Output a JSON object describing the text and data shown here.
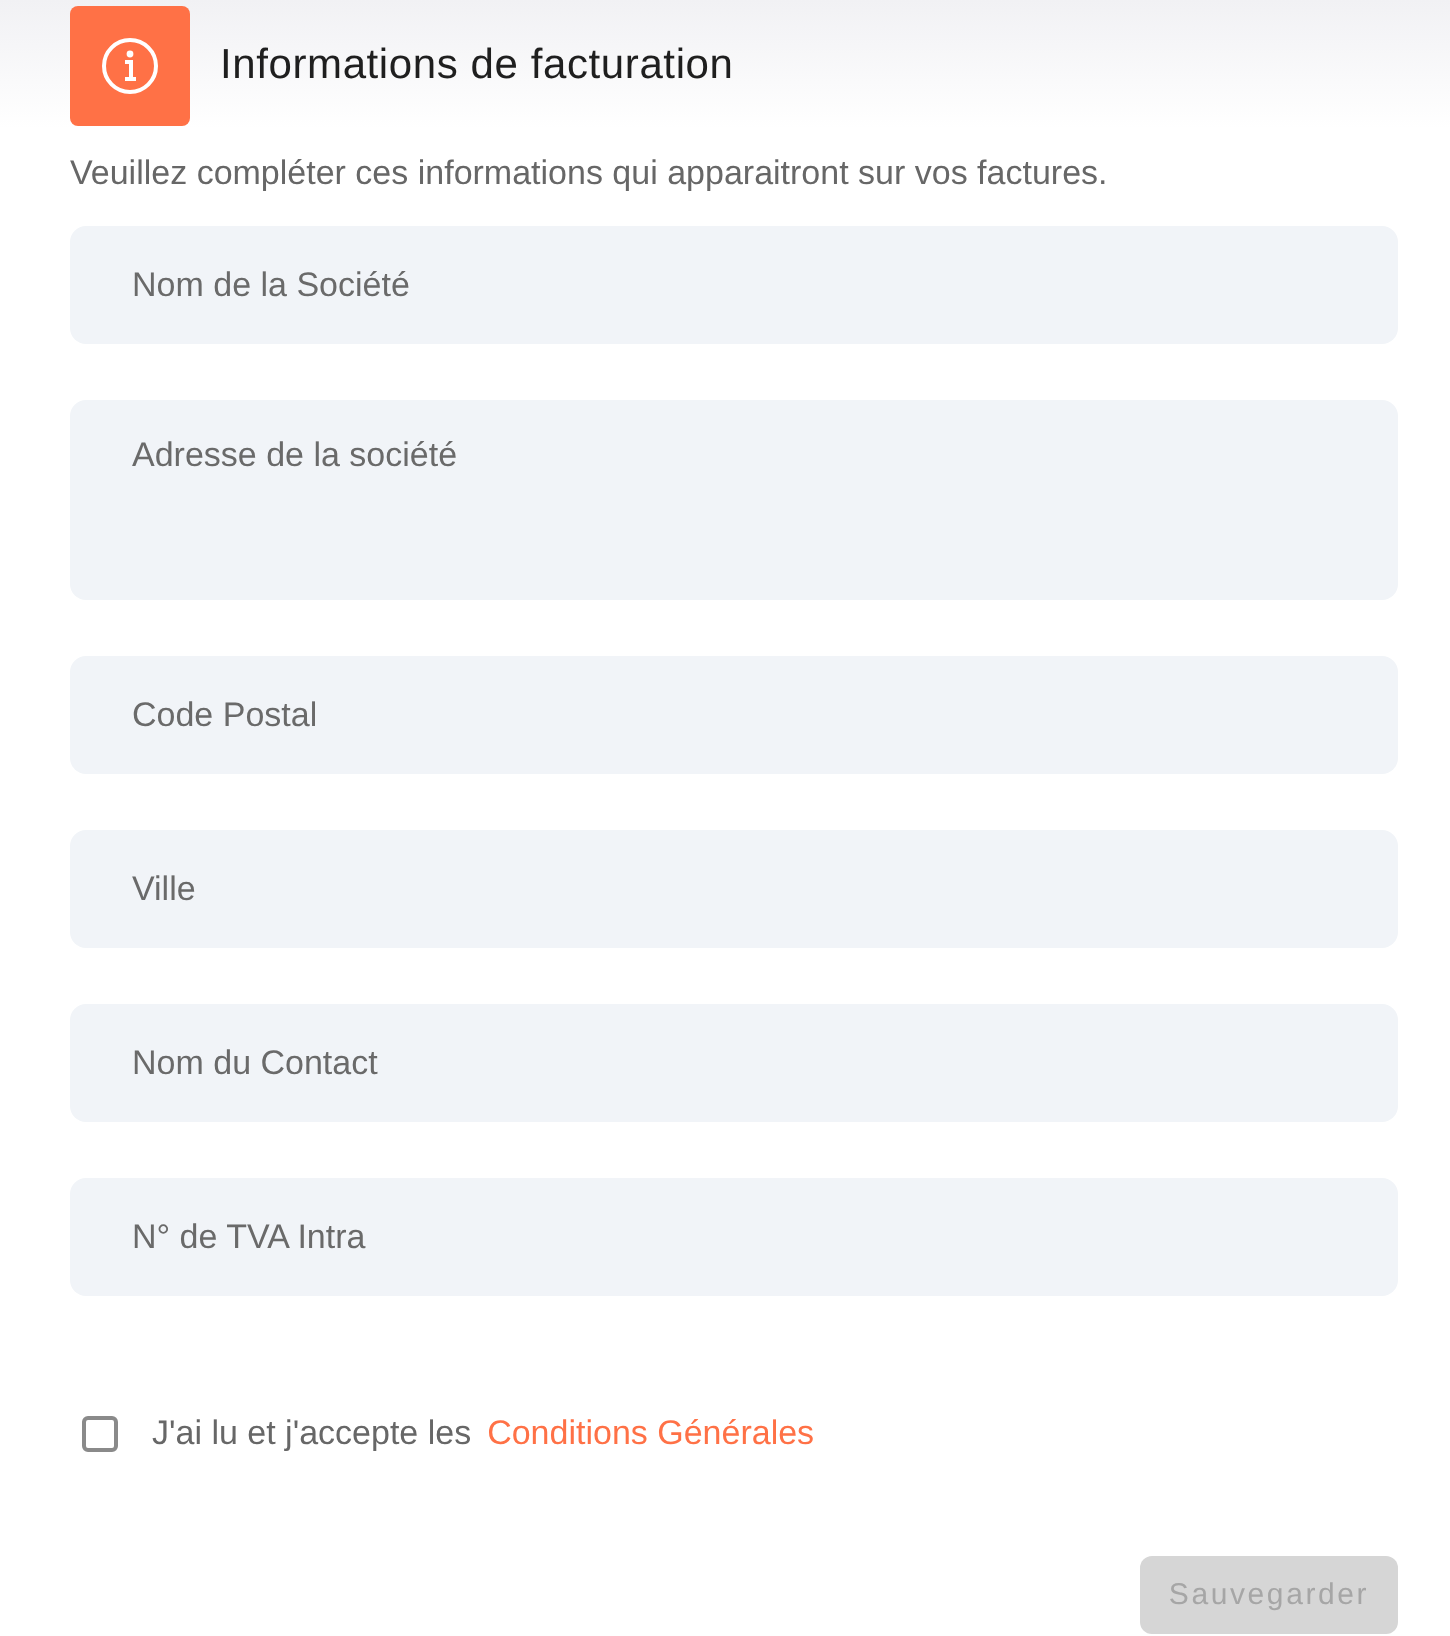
{
  "header": {
    "title": "Informations de facturation"
  },
  "intro": "Veuillez compléter ces informations qui apparaitront sur vos factures.",
  "fields": [
    {
      "kind": "input",
      "placeholder": "Nom de la Société"
    },
    {
      "kind": "textarea",
      "placeholder": "Adresse de la société"
    },
    {
      "kind": "input",
      "placeholder": "Code Postal"
    },
    {
      "kind": "input",
      "placeholder": "Ville"
    },
    {
      "kind": "input",
      "placeholder": "Nom du Contact"
    },
    {
      "kind": "input",
      "placeholder": "N° de TVA Intra"
    }
  ],
  "consent": {
    "text": "J'ai lu et j'accepte les",
    "link": "Conditions Générales",
    "checked": false
  },
  "save_button": {
    "label": "Sauvegarder",
    "disabled": true
  }
}
